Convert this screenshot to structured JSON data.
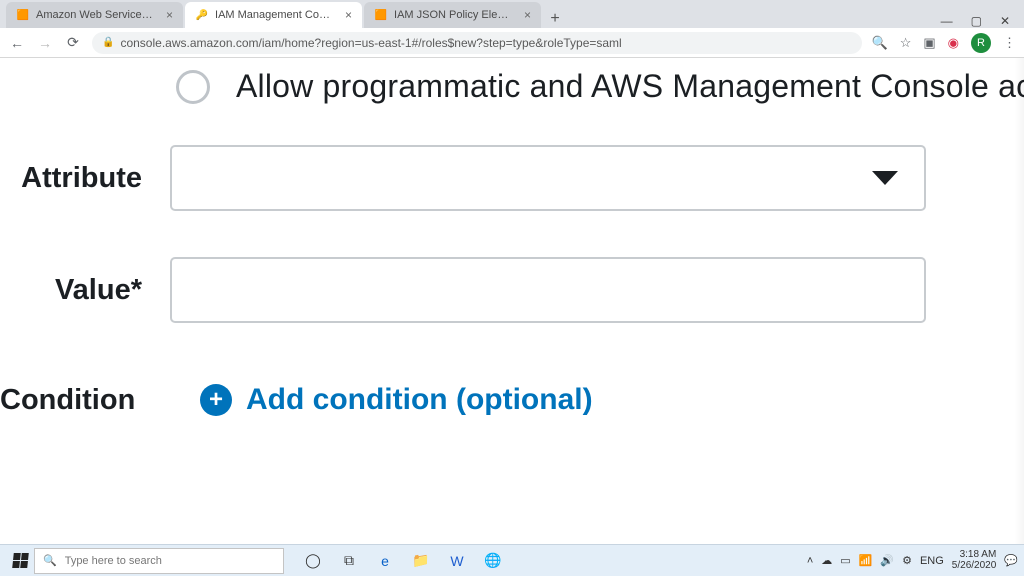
{
  "browser": {
    "tabs": [
      {
        "title": "Amazon Web Services Sign-In",
        "favicon": "🟧"
      },
      {
        "title": "IAM Management Console",
        "favicon": "🔑"
      },
      {
        "title": "IAM JSON Policy Elements Refere",
        "favicon": "🟧"
      }
    ],
    "url": "console.aws.amazon.com/iam/home?region=us-east-1#/roles$new?step=type&roleType=saml",
    "avatar_initial": "R"
  },
  "form": {
    "radio_option_label": "Allow programmatic and AWS Management Console acce",
    "attribute_label": "Attribute",
    "attribute_value": "",
    "value_label": "Value*",
    "value_value": "",
    "condition_label": "Condition",
    "add_condition_label": "Add condition (optional)"
  },
  "taskbar": {
    "search_placeholder": "Type here to search",
    "lang": "ENG",
    "time": "3:18 AM",
    "date": "5/26/2020"
  }
}
